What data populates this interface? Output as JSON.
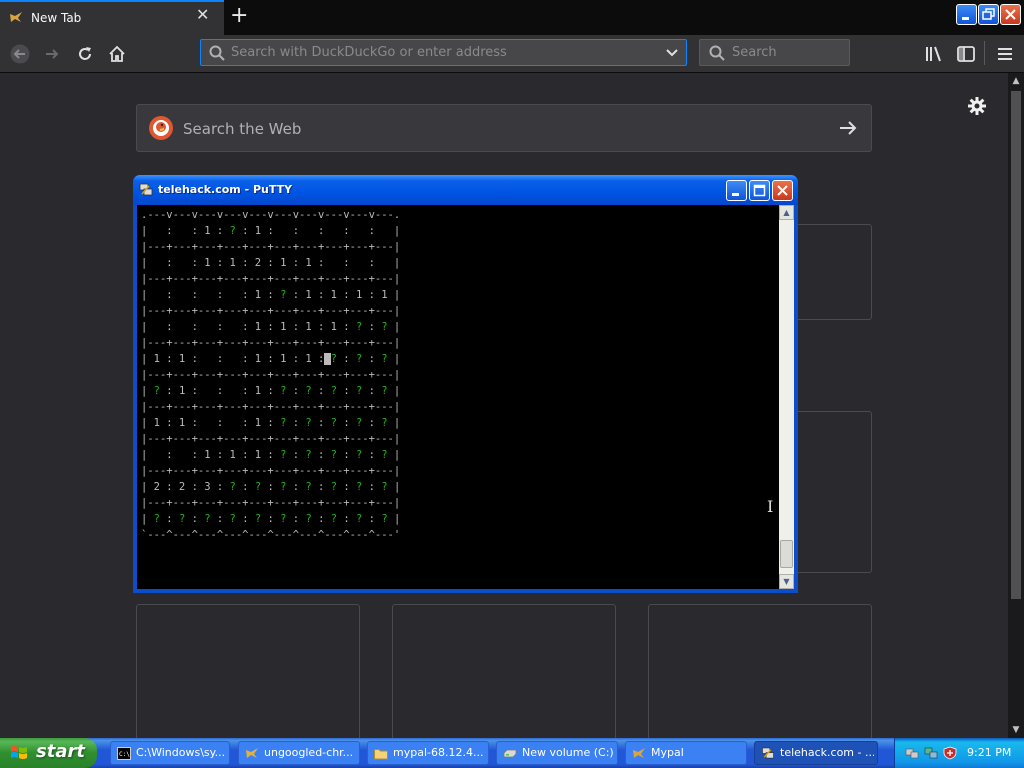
{
  "browser": {
    "tab": {
      "title": "New Tab",
      "close_icon": "close-icon"
    },
    "newtab_icon": "plus-icon",
    "url": {
      "placeholder": "Search with DuckDuckGo or enter address",
      "value": ""
    },
    "search": {
      "placeholder": "Search",
      "value": ""
    },
    "accent": "#0a84ff"
  },
  "newtab": {
    "search_label": "Search the Web"
  },
  "putty": {
    "title": "telehack.com - PuTTY",
    "terminal_lines": [
      ".---v---v---v---v---v---v---v---v---v---.",
      "|   :   : 1 : ? : 1 :   :   :   :   :   |",
      "|---+---+---+---+---+---+---+---+---+---|",
      "|   :   : 1 : 1 : 2 : 1 : 1 :   :   :   |",
      "|---+---+---+---+---+---+---+---+---+---|",
      "|   :   :   :   : 1 : ? : 1 : 1 : 1 : 1 |",
      "|---+---+---+---+---+---+---+---+---+---|",
      "|   :   :   :   : 1 : 1 : 1 : 1 : ? : ? |",
      "|---+---+---+---+---+---+---+---+---+---|",
      "| 1 : 1 :   :   : 1 : 1 : 1 : ? : ? : ? |",
      "|---+---+---+---+---+---+---+---+---+---|",
      "| ? : 1 :   :   : 1 : ? : ? : ? : ? : ? |",
      "|---+---+---+---+---+---+---+---+---+---|",
      "| 1 : 1 :   :   : 1 : ? : ? : ? : ? : ? |",
      "|---+---+---+---+---+---+---+---+---+---|",
      "|   :   : 1 : 1 : 1 : ? : ? : ? : ? : ? |",
      "|---+---+---+---+---+---+---+---+---+---|",
      "| 2 : 2 : 3 : ? : ? : ? : ? : ? : ? : ? |",
      "|---+---+---+---+---+---+---+---+---+---|",
      "| ? : ? : ? : ? : ? : ? : ? : ? : ? : ? |",
      "`---^---^---^---^---^---^---^---^---^---'"
    ],
    "cursor": {
      "line": 9,
      "col": 29
    },
    "unknown_color": "#22b022"
  },
  "taskbar": {
    "start_label": "start",
    "tasks": [
      {
        "label": "C:\\Windows\\sy...",
        "icon": "console-icon"
      },
      {
        "label": "ungoogled-chr...",
        "icon": "chromium-icon"
      },
      {
        "label": "mypal-68.12.4...",
        "icon": "folder-icon"
      },
      {
        "label": "New volume (C:)",
        "icon": "drive-icon"
      },
      {
        "label": "Mypal",
        "icon": "mypal-icon"
      },
      {
        "label": "telehack.com - ...",
        "icon": "putty-icon",
        "active": true
      }
    ],
    "clock": "9:21 PM"
  }
}
